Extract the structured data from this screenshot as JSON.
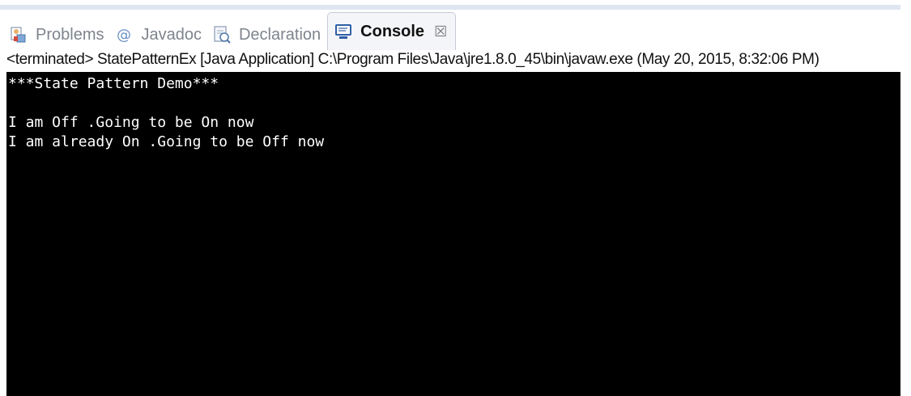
{
  "tabs": [
    {
      "label": "Problems",
      "icon": "problems-icon",
      "active": false
    },
    {
      "label": "Javadoc",
      "icon": "at-sign-icon",
      "active": false
    },
    {
      "label": "Declaration",
      "icon": "declaration-icon",
      "active": false
    },
    {
      "label": "Console",
      "icon": "console-icon",
      "active": true,
      "close_glyph": "☒"
    }
  ],
  "status_line": "<terminated> StatePatternEx [Java Application] C:\\Program Files\\Java\\jre1.8.0_45\\bin\\javaw.exe (May 20, 2015, 8:32:06 PM)",
  "console_lines": [
    "***State Pattern Demo***",
    "",
    "I am Off .Going to be On now",
    "I am already On .Going to be Off now"
  ],
  "colors": {
    "console_bg": "#000000",
    "console_fg": "#ffffff",
    "tab_active_bg": "#f3f5f8",
    "tab_inactive_text": "#7e848d"
  }
}
